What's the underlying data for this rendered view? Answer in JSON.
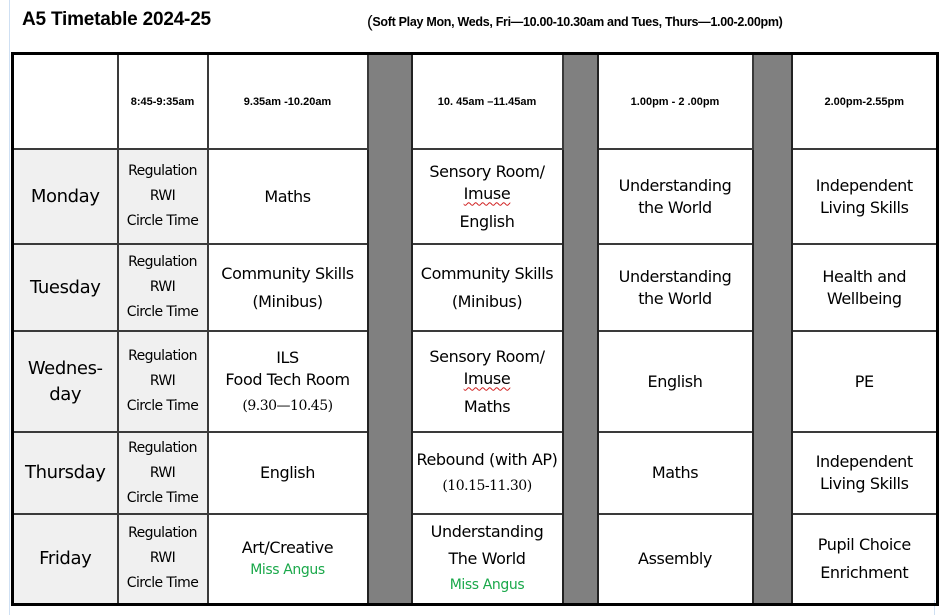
{
  "document": {
    "title": "A5 Timetable 2024-25",
    "note_open_paren": "(",
    "note": "Soft Play Mon, Weds, Fri—10.00-10.30am and Tues, Thurs—1.00-2.00pm)"
  },
  "timetable": {
    "corner": "",
    "headers": [
      "8:45-9:35am",
      "9.35am -10.20am",
      "10. 45am –11.45am",
      "1.00pm - 2 .00pm",
      "2.00pm-2.55pm"
    ],
    "break_color": "#808080",
    "day_cell_color": "#f0f0f0",
    "teacher_color": "#1aa84a",
    "rows": [
      {
        "day": "Monday",
        "reg": [
          "Regulation",
          "RWI",
          "Circle Time"
        ],
        "p2": [
          "Maths"
        ],
        "p3": [
          "Sensory Room/",
          "Imuse",
          "English"
        ],
        "p4": [
          "Understanding",
          "the World"
        ],
        "p5": [
          "Independent",
          "Living Skills"
        ]
      },
      {
        "day": "Tuesday",
        "reg": [
          "Regulation",
          "RWI",
          "Circle Time"
        ],
        "p2": [
          "Community Skills",
          "(Minibus)"
        ],
        "p3": [
          "Community Skills",
          "(Minibus)"
        ],
        "p4": [
          "Understanding",
          "the World"
        ],
        "p5": [
          "Health and",
          "Wellbeing"
        ]
      },
      {
        "day_line1": "Wednes-",
        "day_line2": "day",
        "reg": [
          "Regulation",
          "RWI",
          "Circle Time"
        ],
        "p2": [
          "ILS",
          "Food Tech Room",
          "(9.30—10.45)"
        ],
        "p3": [
          "Sensory Room/",
          "Imuse",
          "Maths"
        ],
        "p4": [
          "English"
        ],
        "p5": [
          "PE"
        ]
      },
      {
        "day": "Thursday",
        "reg": [
          "Regulation",
          "RWI",
          "Circle Time"
        ],
        "p2": [
          "English"
        ],
        "p3": [
          "Rebound (with AP)",
          "(10.15-11.30)"
        ],
        "p4": [
          "Maths"
        ],
        "p5": [
          "Independent",
          "Living Skills"
        ]
      },
      {
        "day": "Friday",
        "reg": [
          "Regulation",
          "RWI",
          "Circle Time"
        ],
        "p2": [
          "Art/Creative",
          "Miss Angus"
        ],
        "p3": [
          "Understanding",
          "The World",
          "Miss Angus"
        ],
        "p4": [
          "Assembly"
        ],
        "p5": [
          "Pupil Choice",
          "Enrichment"
        ]
      }
    ]
  }
}
